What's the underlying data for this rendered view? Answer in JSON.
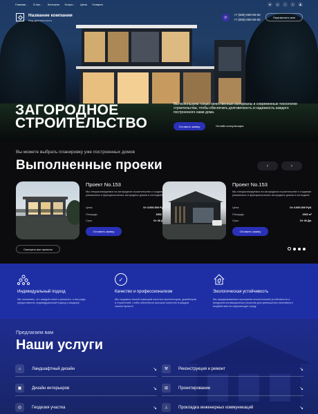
{
  "nav": [
    {
      "label": "Главная",
      "caret": true
    },
    {
      "label": "О нас",
      "caret": true
    },
    {
      "label": "Контакты",
      "caret": false
    },
    {
      "label": "Услуги",
      "caret": true
    },
    {
      "label": "Цены",
      "caret": false
    },
    {
      "label": "Галерея",
      "caret": false
    }
  ],
  "socials": [
    "telegram-icon",
    "vk-icon",
    "whatsapp-icon",
    "twitter-icon",
    "odnoklassniki-icon"
  ],
  "company": {
    "name": "Название компании",
    "activity": "Вид деятельности"
  },
  "contacts": {
    "phone1": "+7 (000) 000-00-00",
    "phone2": "+7 (000) 000-00-00",
    "callback": "Перезвонить мне"
  },
  "hero": {
    "title_line1": "ЗАГОРОДНОЕ",
    "title_line2": "СТРОИТЕЛЬСТВО",
    "desc": "Мы используем только качественные материалы и современные технологии строительства, чтобы обеспечить долговечность и надежность каждого построенного нами дома.",
    "order": "Оставить заявку",
    "consult": "Онлайн консультация"
  },
  "projects": {
    "subtitle": "Вы можете выбрать планировку уже построенных домов",
    "title": "Выполненные проеки",
    "prev": "‹",
    "next": "›",
    "all": "Смотреть все проекты",
    "cards": [
      {
        "title": "Проект No.153",
        "desc": "Мы специализируемся на загородном строительстве и создании уникальных и функциональных загородных домов и коттеджей.",
        "price_label": "Цена:",
        "price_value": "От 3.000.000 Руб.",
        "area_label": "Площадь:",
        "area_value": "1502 м²",
        "term_label": "Срок:",
        "term_value": "От 46 Дн.",
        "button": "Оставить заявку"
      },
      {
        "title": "Проект No.153",
        "desc": "Мы специализируемся на загородном строительстве и создании уникальных и функциональных загородных домов и коттеджей.",
        "price_label": "Цена:",
        "price_value": "От 3.000.000 Руб.",
        "area_label": "Площадь:",
        "area_value": "1502 м²",
        "term_label": "Срок:",
        "term_value": "От 46 Дн.",
        "button": "Оставить заявку"
      }
    ]
  },
  "features": [
    {
      "icon": "people-icon",
      "title": "Индивидуальный подход",
      "desc": "Мы понимаем, что каждый клиент уникален, и мы рады предоставлять индивидуальный подход к каждому"
    },
    {
      "icon": "check-icon",
      "title": "Качество и профессионализм",
      "desc": "Мы гордимся нашей командой опытных архитекторов, дизайнеров и строителей, чтобы обеспечить высокое качество в каждом нашем проекте"
    },
    {
      "icon": "eco-house-icon",
      "title": "Экологическая устойчивость",
      "desc": "Мы придерживаемся принципов экологической устойчивости и внедряем инновационные решения для уменьшения негативного воздействия на окружающую среду"
    }
  ],
  "services": {
    "subtitle": "Предлагаем вам",
    "title": "Наши услуги",
    "items": [
      {
        "label": "Ландшафтный дизайн",
        "icon": "landscape-icon"
      },
      {
        "label": "Реконструкция и ремонт",
        "icon": "repair-icon"
      },
      {
        "label": "Дизайн интерьеров",
        "icon": "interior-icon"
      },
      {
        "label": "Проектирование",
        "icon": "blueprint-icon"
      },
      {
        "label": "Геодезия участка",
        "icon": "geodesy-icon"
      },
      {
        "label": "Прокладка инженерных коммуникаций",
        "icon": "pipes-icon"
      }
    ]
  },
  "colors": {
    "accent": "#2a31b8",
    "features_bg": "#1e2fa6",
    "dark_bg": "#0c0c0f"
  }
}
